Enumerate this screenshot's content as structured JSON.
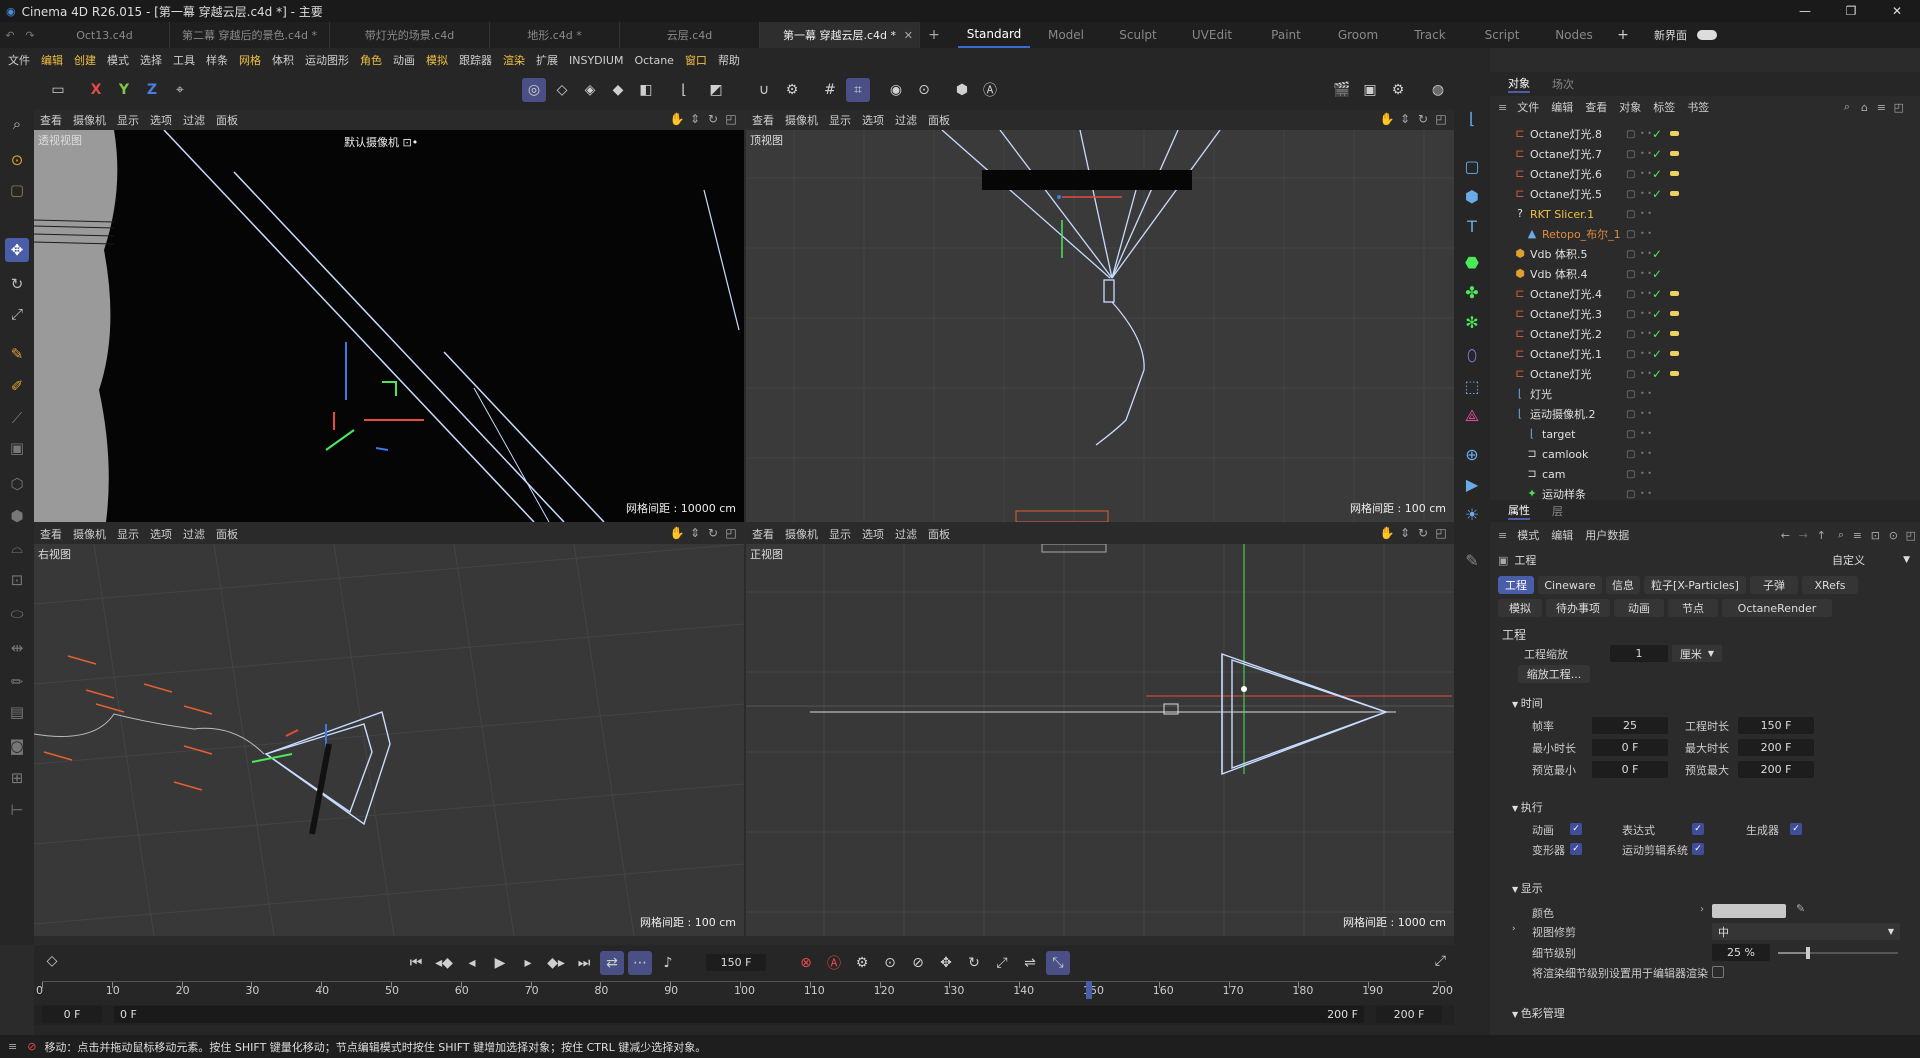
{
  "window": {
    "title": "Cinema 4D R26.015 - [第一幕 穿越云层.c4d *] - 主要",
    "controls": [
      "—",
      "❐",
      "✕"
    ]
  },
  "doc_tabs": [
    {
      "label": "Oct13.c4d",
      "active": false
    },
    {
      "label": "第二幕 穿越后的景色.c4d *",
      "active": false
    },
    {
      "label": "带灯光的场景.c4d",
      "active": false
    },
    {
      "label": "地形.c4d *",
      "active": false
    },
    {
      "label": "云层.c4d",
      "active": false
    },
    {
      "label": "第一幕 穿越云层.c4d *",
      "active": true
    }
  ],
  "add_tab": "+",
  "layouts": [
    "Standard",
    "Model",
    "Sculpt",
    "UVEdit",
    "Paint",
    "Groom",
    "Track",
    "Script",
    "Nodes"
  ],
  "layout_add": "+",
  "new_interface": "新界面",
  "menu": [
    "文件",
    "编辑",
    "创建",
    "模式",
    "选择",
    "工具",
    "样条",
    "网格",
    "体积",
    "运动图形",
    "角色",
    "动画",
    "模拟",
    "跟踪器",
    "渲染",
    "扩展",
    "INSYDIUM",
    "Octane",
    "窗口",
    "帮助"
  ],
  "axis_buttons": [
    "X",
    "Y",
    "Z"
  ],
  "viewports": {
    "menu": [
      "查看",
      "摄像机",
      "显示",
      "选项",
      "过滤",
      "面板"
    ],
    "perspective": {
      "label": "透视视图",
      "camera": "默认摄像机 ⊡•",
      "grid": "网格间距 : 10000 cm"
    },
    "top": {
      "label": "顶视图",
      "grid": "网格间距 : 100 cm"
    },
    "right": {
      "label": "右视图",
      "grid": "网格间距 : 100 cm"
    },
    "front": {
      "label": "正视图",
      "grid": "网格间距 : 1000 cm"
    }
  },
  "timeline": {
    "current_frame": "150 F",
    "ruler": [
      "0",
      "10",
      "20",
      "30",
      "40",
      "50",
      "60",
      "70",
      "80",
      "90",
      "100",
      "110",
      "120",
      "130",
      "140",
      "150",
      "160",
      "170",
      "180",
      "190",
      "200"
    ],
    "start_field": "0 F",
    "start_field2": "0 F",
    "end_field": "200 F",
    "end_field2": "200 F",
    "playhead_frame": 150
  },
  "status": "移动：点击并拖动鼠标移动元素。按住 SHIFT 键量化移动；节点编辑模式时按住 SHIFT 键增加选择对象；按住 CTRL 键减少选择对象。",
  "object_manager": {
    "tabs": [
      "对象",
      "场次"
    ],
    "menu": [
      "文件",
      "编辑",
      "查看",
      "对象",
      "标签",
      "书签"
    ],
    "objects": [
      {
        "name": "Octane灯光.8",
        "icon": "light",
        "color": "#e0e0e0",
        "indent": 0,
        "check": true,
        "tag": true
      },
      {
        "name": "Octane灯光.7",
        "icon": "light",
        "color": "#e0e0e0",
        "indent": 0,
        "check": true,
        "tag": true
      },
      {
        "name": "Octane灯光.6",
        "icon": "light",
        "color": "#e0e0e0",
        "indent": 0,
        "check": true,
        "tag": true
      },
      {
        "name": "Octane灯光.5",
        "icon": "light",
        "color": "#e0e0e0",
        "indent": 0,
        "check": true,
        "tag": true
      },
      {
        "name": "RKT Slicer.1",
        "icon": "slicer",
        "color": "#f0c040",
        "indent": 0,
        "check": false,
        "tag": false
      },
      {
        "name": "Retopo_布尔_1",
        "icon": "mesh",
        "color": "#e08a40",
        "indent": 1,
        "check": false,
        "tag": false
      },
      {
        "name": "Vdb 体积.5",
        "icon": "vdb",
        "color": "#e0e0e0",
        "indent": 0,
        "check": true,
        "tag": false
      },
      {
        "name": "Vdb 体积.4",
        "icon": "vdb",
        "color": "#e0e0e0",
        "indent": 0,
        "check": true,
        "tag": false
      },
      {
        "name": "Octane灯光.4",
        "icon": "light",
        "color": "#e0e0e0",
        "indent": 0,
        "check": true,
        "tag": true
      },
      {
        "name": "Octane灯光.3",
        "icon": "light",
        "color": "#e0e0e0",
        "indent": 0,
        "check": true,
        "tag": true
      },
      {
        "name": "Octane灯光.2",
        "icon": "light",
        "color": "#e0e0e0",
        "indent": 0,
        "check": true,
        "tag": true
      },
      {
        "name": "Octane灯光.1",
        "icon": "light",
        "color": "#e0e0e0",
        "indent": 0,
        "check": true,
        "tag": true
      },
      {
        "name": "Octane灯光",
        "icon": "light",
        "color": "#e0e0e0",
        "indent": 0,
        "check": true,
        "tag": true
      },
      {
        "name": "灯光",
        "icon": "null",
        "color": "#e0e0e0",
        "indent": 0,
        "check": false,
        "tag": false
      },
      {
        "name": "运动摄像机.2",
        "icon": "null",
        "color": "#e0e0e0",
        "indent": 0,
        "check": false,
        "tag": false
      },
      {
        "name": "target",
        "icon": "null",
        "color": "#e0e0e0",
        "indent": 1,
        "check": false,
        "tag": false
      },
      {
        "name": "camlook",
        "icon": "camera",
        "color": "#e0e0e0",
        "indent": 1,
        "check": false,
        "tag": false
      },
      {
        "name": "cam",
        "icon": "camera",
        "color": "#e0e0e0",
        "indent": 1,
        "check": false,
        "tag": false
      },
      {
        "name": "运动样条",
        "icon": "spline",
        "color": "#e0e0e0",
        "indent": 1,
        "check": false,
        "tag": false
      }
    ]
  },
  "attributes": {
    "tabs": [
      "属性",
      "层"
    ],
    "menu": [
      "模式",
      "编辑",
      "用户数据"
    ],
    "object": "工程",
    "preset": "自定义",
    "tabs_row1": [
      "工程",
      "Cineware",
      "信息",
      "粒子[X-Particles]",
      "子弹",
      "XRefs"
    ],
    "tabs_row2": [
      "模拟",
      "待办事项",
      "动画",
      "节点",
      "OctaneRender"
    ],
    "section": "工程",
    "project_scale_label": "工程缩放",
    "project_scale": "1",
    "unit": "厘米",
    "scale_button": "缩放工程...",
    "time": {
      "title": "时间",
      "fps_label": "帧率",
      "fps": "25",
      "duration_label": "工程时长",
      "duration": "150 F",
      "min_label": "最小时长",
      "min": "0 F",
      "max_label": "最大时长",
      "max": "200 F",
      "pmin_label": "预览最小",
      "pmin": "0 F",
      "pmax_label": "预览最大",
      "pmax": "200 F"
    },
    "exec": {
      "title": "执行",
      "animation": "动画",
      "expression": "表达式",
      "generator": "生成器",
      "deformer": "变形器",
      "motion": "运动剪辑系统"
    },
    "display": {
      "title": "显示",
      "color_label": "颜色",
      "color": "#c8c8c8",
      "clip_label": "视图修剪",
      "clip": "中",
      "lod_label": "细节级别",
      "lod": "25 %",
      "lod_level": 0.25,
      "lod_render": "将渲染细节级别设置用于编辑器渲染"
    },
    "color_mgmt": "色彩管理"
  }
}
